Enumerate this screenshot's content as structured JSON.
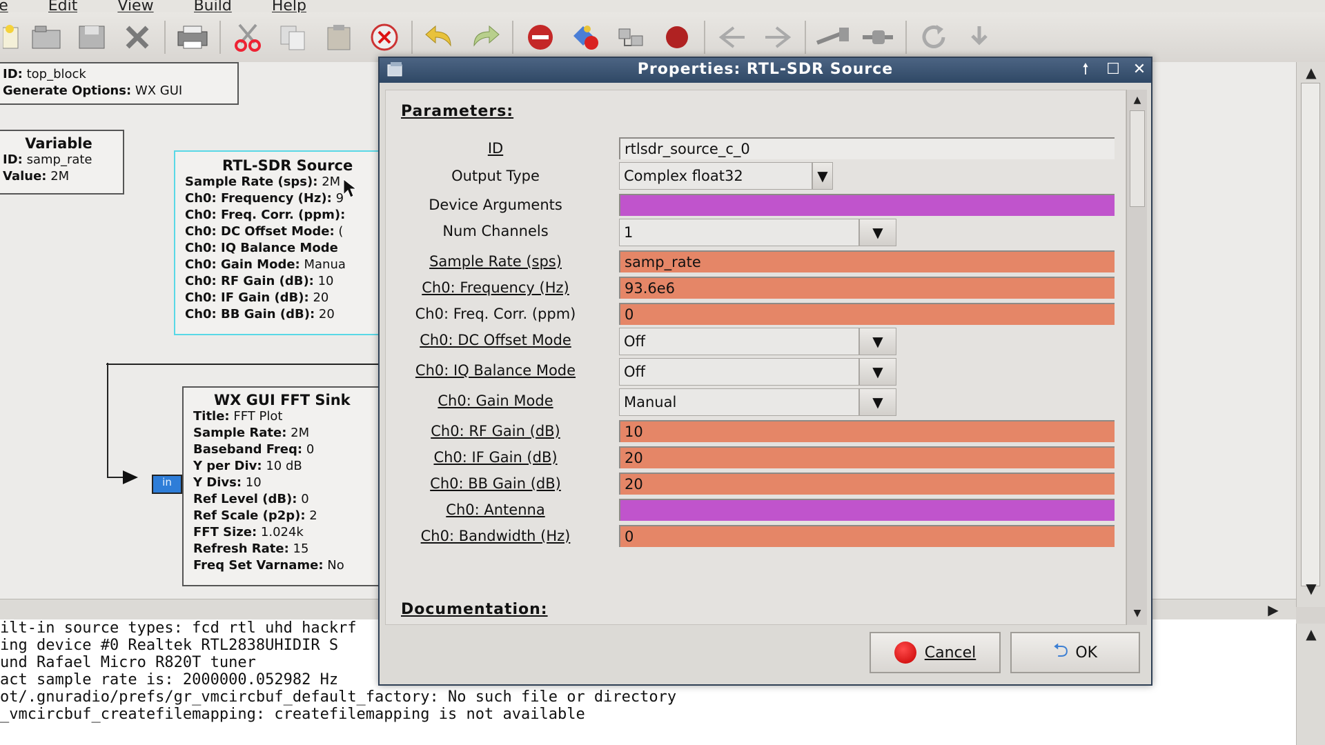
{
  "menubar": {
    "items": [
      "ile",
      "Edit",
      "View",
      "Build",
      "Help"
    ]
  },
  "toolbar": {
    "icons": [
      "new-icon",
      "open-icon",
      "save-icon",
      "close-icon",
      "print-icon",
      "cut-icon",
      "copy-icon",
      "paste-icon",
      "delete-icon",
      "undo-icon",
      "redo-icon",
      "disable-icon",
      "generate-icon",
      "execute-icon",
      "stop-icon",
      "back-icon",
      "forward-icon",
      "rotate-ccw-icon",
      "rotate-cw-icon",
      "reload-icon",
      "find-icon"
    ]
  },
  "canvas": {
    "top_block": {
      "id_label": "ID:",
      "id_value": "top_block",
      "gen_label": "Generate Options:",
      "gen_value": "WX GUI"
    },
    "variable_block": {
      "title": "Variable",
      "id_label": "ID:",
      "id_value": "samp_rate",
      "value_label": "Value:",
      "value_value": "2M"
    },
    "rtl_block": {
      "title": "RTL-SDR Source",
      "rows": [
        {
          "label": "Sample Rate (sps):",
          "value": "2M"
        },
        {
          "label": "Ch0: Frequency (Hz):",
          "value": "9"
        },
        {
          "label": "Ch0: Freq. Corr. (ppm):",
          "value": ""
        },
        {
          "label": "Ch0: DC Offset Mode:",
          "value": "("
        },
        {
          "label": "Ch0: IQ Balance Mode",
          "value": ""
        },
        {
          "label": "Ch0: Gain Mode:",
          "value": "Manua"
        },
        {
          "label": "Ch0: RF Gain (dB):",
          "value": "10"
        },
        {
          "label": "Ch0: IF Gain (dB):",
          "value": "20"
        },
        {
          "label": "Ch0: BB Gain (dB):",
          "value": "20"
        }
      ]
    },
    "fft_block": {
      "title": "WX GUI FFT Sink",
      "port_label": "in",
      "rows": [
        {
          "label": "Title:",
          "value": "FFT Plot"
        },
        {
          "label": "Sample Rate:",
          "value": "2M"
        },
        {
          "label": "Baseband Freq:",
          "value": "0"
        },
        {
          "label": "Y per Div:",
          "value": "10 dB"
        },
        {
          "label": "Y Divs:",
          "value": "10"
        },
        {
          "label": "Ref Level (dB):",
          "value": "0"
        },
        {
          "label": "Ref Scale (p2p):",
          "value": "2"
        },
        {
          "label": "FFT Size:",
          "value": "1.024k"
        },
        {
          "label": "Refresh Rate:",
          "value": "15"
        },
        {
          "label": "Freq Set Varname:",
          "value": "No"
        }
      ]
    }
  },
  "log": {
    "lines": [
      "ilt-in source types: fcd rtl uhd hackrf",
      "ing device #0 Realtek RTL2838UHIDIR S",
      "und Rafael Micro R820T tuner",
      "act sample rate is: 2000000.052982 Hz",
      "ot/.gnuradio/prefs/gr_vmcircbuf_default_factory: No such file or directory",
      "_vmcircbuf_createfilemapping: createfilemapping is not available"
    ]
  },
  "dialog": {
    "title": "Properties: RTL-SDR Source",
    "parameters_heading": "Parameters:",
    "documentation_heading": "Documentation:",
    "params": {
      "id": {
        "label": "ID",
        "value": "rtlsdr_source_c_0"
      },
      "output_type": {
        "label": "Output Type",
        "value": "Complex float32"
      },
      "device_args": {
        "label": "Device Arguments",
        "value": ""
      },
      "num_channels": {
        "label": "Num Channels",
        "value": "1"
      },
      "sample_rate": {
        "label": "Sample Rate (sps)",
        "value": "samp_rate"
      },
      "frequency": {
        "label": "Ch0: Frequency (Hz)",
        "value": "93.6e6"
      },
      "freq_corr": {
        "label": "Ch0: Freq. Corr. (ppm)",
        "value": "0"
      },
      "dc_offset": {
        "label": "Ch0: DC Offset Mode",
        "value": "Off"
      },
      "iq_balance": {
        "label": "Ch0: IQ Balance Mode",
        "value": "Off"
      },
      "gain_mode": {
        "label": "Ch0: Gain Mode",
        "value": "Manual"
      },
      "rf_gain": {
        "label": "Ch0: RF Gain (dB)",
        "value": "10"
      },
      "if_gain": {
        "label": "Ch0: IF Gain (dB)",
        "value": "20"
      },
      "bb_gain": {
        "label": "Ch0: BB Gain (dB)",
        "value": "20"
      },
      "antenna": {
        "label": "Ch0: Antenna",
        "value": ""
      },
      "bandwidth": {
        "label": "Ch0: Bandwidth (Hz)",
        "value": "0"
      }
    },
    "cancel_label": "Cancel",
    "ok_label": "OK"
  },
  "colors": {
    "orange_field": "#e58667",
    "magenta_field": "#c054cc",
    "title_bar": "#2f4865",
    "selected_block": "#58d8e6",
    "port": "#2e7dd8"
  }
}
